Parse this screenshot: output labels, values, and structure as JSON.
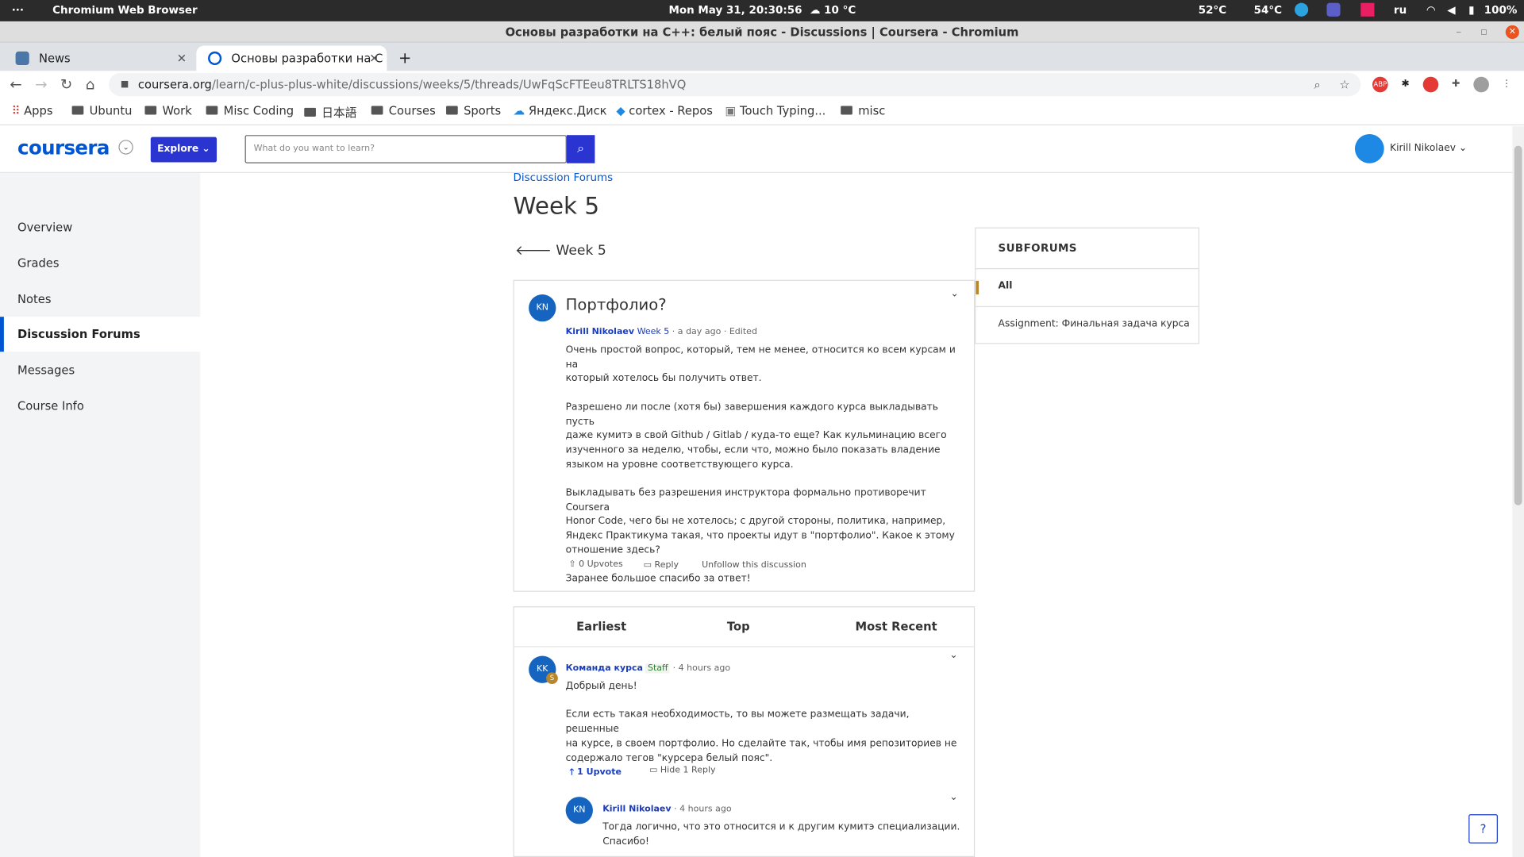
{
  "os": {
    "menu": "···",
    "app": "Chromium Web Browser",
    "clock": "Mon May 31, 20:30:56",
    "weather": "☁ 10 °C",
    "temp1": "52°C",
    "temp2": "54°C",
    "lang": "ru",
    "battery": "100%"
  },
  "window": {
    "title": "Основы разработки на C++: белый пояс - Discussions | Coursera - Chromium"
  },
  "tabs": [
    {
      "label": "News"
    },
    {
      "label": "Основы разработки на С"
    }
  ],
  "address": {
    "host": "coursera.org",
    "path": "/learn/c-plus-plus-white/discussions/weeks/5/threads/UwFqScFTEeu8TRLTS18hVQ"
  },
  "bookmarks": [
    {
      "label": "Apps"
    },
    {
      "label": "Ubuntu"
    },
    {
      "label": "Work"
    },
    {
      "label": "Misc Coding"
    },
    {
      "label": "日本語"
    },
    {
      "label": "Courses"
    },
    {
      "label": "Sports"
    },
    {
      "label": "Яндекс.Диск"
    },
    {
      "label": "cortex - Repos"
    },
    {
      "label": "Touch Typing..."
    },
    {
      "label": "misc"
    }
  ],
  "header": {
    "logo": "coursera",
    "explore": "Explore",
    "search_placeholder": "What do you want to learn?",
    "user": "Kirill Nikolaev"
  },
  "sidebar": {
    "items": [
      {
        "label": "Overview"
      },
      {
        "label": "Grades"
      },
      {
        "label": "Notes"
      },
      {
        "label": "Discussion Forums"
      },
      {
        "label": "Messages"
      },
      {
        "label": "Course Info"
      }
    ]
  },
  "main": {
    "breadcrumb": "Discussion Forums",
    "title": "Week 5",
    "back": "Week 5"
  },
  "post": {
    "initials": "KN",
    "title": "Портфолио?",
    "author": "Kirill Nikolaev",
    "week": "Week 5",
    "time": " · a day ago · Edited",
    "body": "Очень простой вопрос, который, тем не менее, относится ко всем курсам и на\nкоторый хотелось бы получить ответ.\n\nРазрешено ли после (хотя бы) завершения каждого курса выкладывать пусть\nдаже кумитэ в свой Github / Gitlab / куда-то еще? Как кульминацию всего\nизученного за неделю, чтобы, если что, можно было показать владение\nязыком на уровне соответствующего курса.\n\nВыкладывать без разрешения инструктора формально противоречит Coursera\nHonor Code, чего бы не хотелось; с другой стороны, политика, например,\nЯндекс Практикума такая, что проекты идут в \"портфолио\". Какое к этому\nотношение здесь?\n\nЗаранее большое спасибо за ответ!",
    "upvotes": "0 Upvotes",
    "reply": "Reply",
    "unfollow": "Unfollow this discussion"
  },
  "sort": {
    "earliest": "Earliest",
    "top": "Top",
    "recent": "Most Recent"
  },
  "reply1": {
    "initials": "KK",
    "badge": "S",
    "author": "Команда курса",
    "staff": "Staff",
    "time": " · 4 hours ago",
    "body": "Добрый день!\n\nЕсли есть такая необходимость, то вы можете размещать задачи, решенные\nна курсе, в своем портфолио. Но сделайте так, чтобы имя репозиториев не\nсодержало тегов \"курсера белый пояс\".",
    "upvotes": "1 Upvote",
    "hide": "Hide 1 Reply"
  },
  "reply2": {
    "initials": "KN",
    "author": "Kirill Nikolaev",
    "time": " · 4 hours ago",
    "body": "Тогда логично, что это относится и к другим кумитэ специализации.\nСпасибо!"
  },
  "subforums": {
    "heading": "SUBFORUMS",
    "items": [
      {
        "label": "All"
      },
      {
        "label": "Assignment: Финальная задача курса"
      }
    ]
  },
  "colors": {
    "brand": "#0056d2",
    "explore": "#2a35d1"
  }
}
